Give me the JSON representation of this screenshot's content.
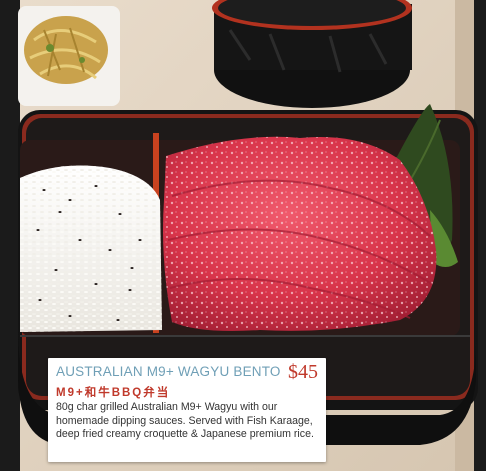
{
  "menu_item": {
    "title": "AUSTRALIAN M9+ WAGYU BENTO",
    "price": "$45",
    "subtitle": "M9+和牛BBQ弁当",
    "description": "80g char grilled Australian M9+ Wagyu with our homemade dipping sauces. Served with Fish Karaage, deep fried creamy croquette & Japanese premium rice."
  },
  "colors": {
    "title": "#6f9fb6",
    "price": "#c0392b",
    "subtitle": "#c0392b",
    "bento_box": "#1c1c1c",
    "bento_rim": "#8a2a1e",
    "wagyu": "#d8344a"
  }
}
